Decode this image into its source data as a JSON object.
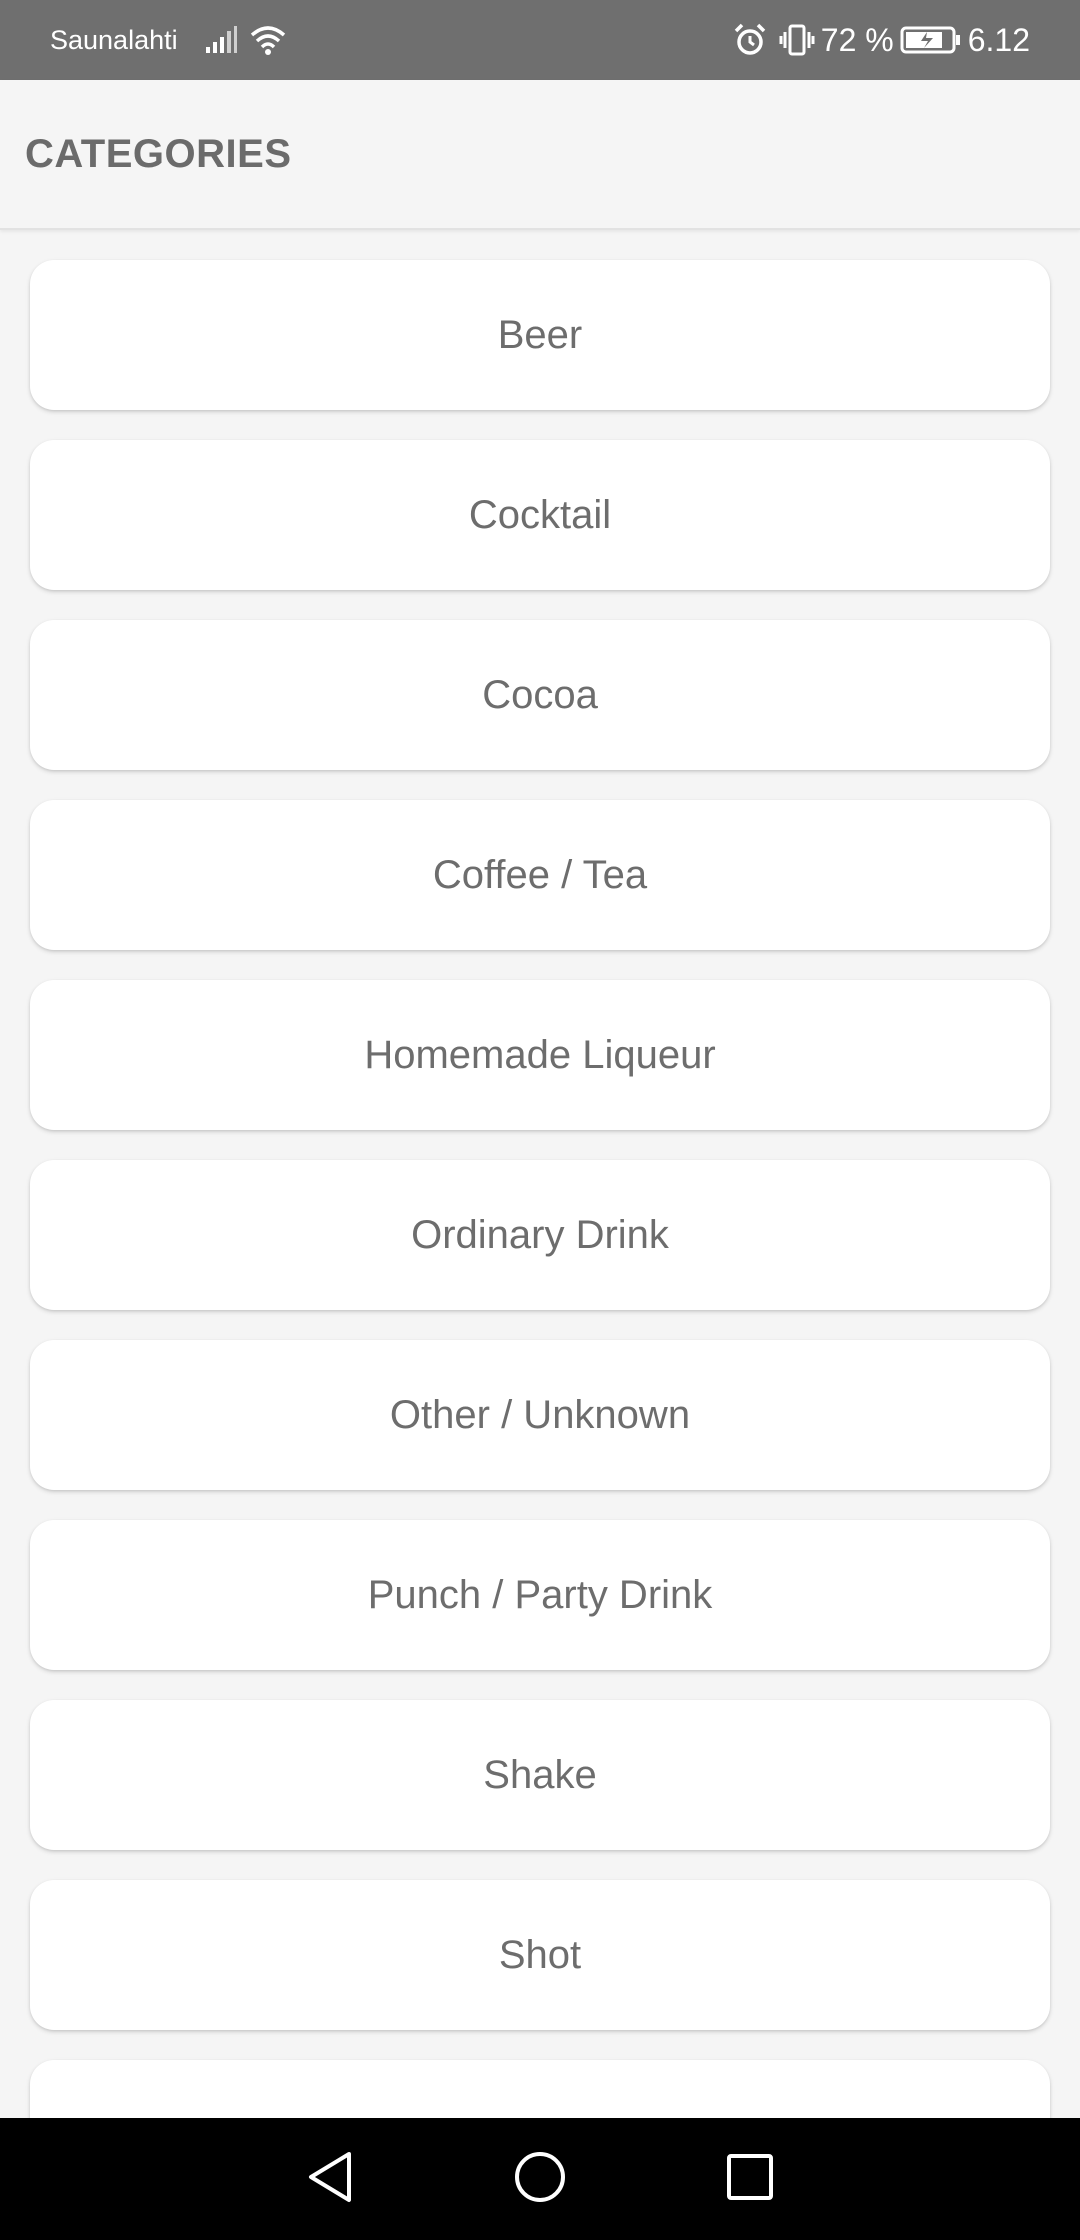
{
  "status_bar": {
    "carrier": "Saunalahti",
    "battery": "72 %",
    "time": "6.12",
    "icons": [
      "signal-icon",
      "wifi-icon",
      "alarm-icon",
      "vibrate-icon",
      "battery-icon"
    ]
  },
  "app_bar": {
    "title": "CATEGORIES"
  },
  "categories": [
    {
      "label": "Beer"
    },
    {
      "label": "Cocktail"
    },
    {
      "label": "Cocoa"
    },
    {
      "label": "Coffee / Tea"
    },
    {
      "label": "Homemade Liqueur"
    },
    {
      "label": "Ordinary Drink"
    },
    {
      "label": "Other / Unknown"
    },
    {
      "label": "Punch / Party Drink"
    },
    {
      "label": "Shake"
    },
    {
      "label": "Shot"
    },
    {
      "label": ""
    }
  ],
  "nav_bar": {
    "buttons": [
      "back-icon",
      "home-icon",
      "recents-icon"
    ]
  },
  "colors": {
    "status_bar_bg": "#6f6f6f",
    "background": "#f5f5f5",
    "card_bg": "#ffffff",
    "text": "#6d6d6d",
    "nav_bar_bg": "#000000"
  }
}
